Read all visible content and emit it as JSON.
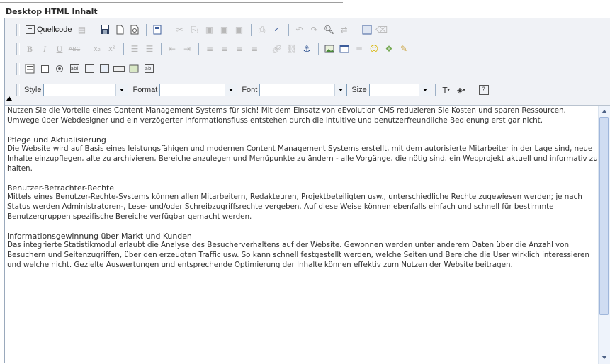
{
  "header": {
    "title": "Desktop HTML Inhalt"
  },
  "toolbar": {
    "source_label": "Quellcode",
    "style_label": "Style",
    "format_label": "Format",
    "font_label": "Font",
    "size_label": "Size",
    "style_value": "",
    "format_value": "",
    "font_value": "",
    "size_value": ""
  },
  "content": {
    "intro": "Nutzen Sie die Vorteile eines Content Management Systems für sich! Mit dem Einsatz von eEvolution CMS reduzieren Sie Kosten und sparen Ressourcen. Umwege über Webdesigner und ein verzögerter Informationsfluss entstehen durch die intuitive und benutzerfreundliche Bedienung erst gar nicht.",
    "sections": [
      {
        "heading": "Pflege und Aktualisierung",
        "body": "Die Website wird auf Basis eines leistungsfähigen und modernen Content Management Systems erstellt, mit dem autorisierte Mitarbeiter in der Lage sind, neue Inhalte einzupflegen, alte zu archivieren, Bereiche anzulegen und Menüpunkte zu ändern - alle Vorgänge, die nötig sind, ein Webprojekt aktuell und informativ zu halten."
      },
      {
        "heading": "Benutzer-Betrachter-Rechte",
        "body": "Mittels eines Benutzer-Rechte-Systems können allen Mitarbeitern, Redakteuren, Projektbeteiligten usw., unterschiedliche Rechte zugewiesen werden; je nach Status werden Administratoren-, Lese- und/oder Schreibzugriffsrechte vergeben. Auf diese Weise können ebenfalls einfach und schnell für bestimmte Benutzergruppen spezifische Bereiche verfügbar gemacht werden."
      },
      {
        "heading": "Informationsgewinnung über Markt und Kunden",
        "body": "Das integrierte Statistikmodul erlaubt die Analyse des Besucherverhaltens auf der Website. Gewonnen werden unter anderem Daten über die Anzahl von Besuchern und Seitenzugriffen, über den erzeugten Traffic usw. So kann schnell festgestellt werden, welche Seiten und Bereiche die User wirklich interessieren und welche nicht. Gezielte Auswertungen und entsprechende Optimierung der Inhalte können effektiv zum Nutzen der Website beitragen."
      }
    ]
  },
  "colors": {
    "accent": "#316ac5",
    "border": "#9aa9bc",
    "toolbar_bg": "#f0f2f6"
  }
}
